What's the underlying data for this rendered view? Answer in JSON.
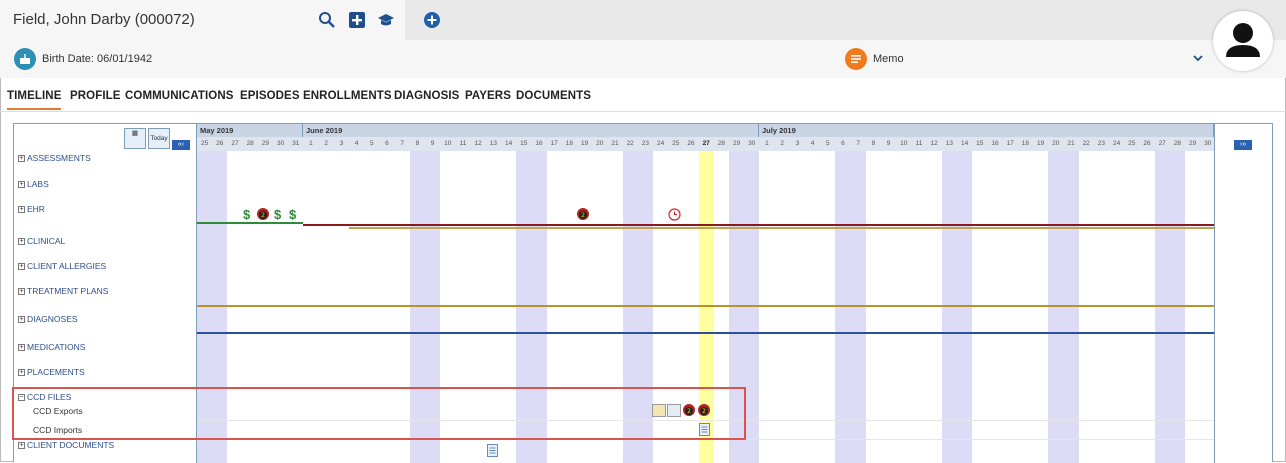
{
  "patient": {
    "name": "Field, John Darby (000072)",
    "birth_date": "Birth Date: 06/01/1942"
  },
  "memo": {
    "label": "Memo"
  },
  "tabs": [
    {
      "label": "TIMELINE",
      "active": true
    },
    {
      "label": "PROFILE"
    },
    {
      "label": "COMMUNICATIONS"
    },
    {
      "label": "EPISODES"
    },
    {
      "label": "ENROLLMENTS"
    },
    {
      "label": "DIAGNOSIS"
    },
    {
      "label": "PAYERS"
    },
    {
      "label": "DOCUMENTS"
    }
  ],
  "timeline": {
    "today_label": "Today",
    "months": [
      "May 2019",
      "June 2019",
      "July 2019"
    ],
    "categories": [
      "ASSESSMENTS",
      "LABS",
      "EHR",
      "CLINICAL",
      "CLIENT ALLERGIES",
      "TREATMENT PLANS",
      "DIAGNOSES",
      "MEDICATIONS",
      "PLACEMENTS",
      "CCD FILES",
      "CLIENT DOCUMENTS"
    ],
    "subcategories": [
      "CCD Exports",
      "CCD Imports"
    ],
    "days": [
      "25",
      "26",
      "27",
      "28",
      "29",
      "30",
      "31",
      "1",
      "2",
      "3",
      "4",
      "5",
      "6",
      "7",
      "8",
      "9",
      "10",
      "11",
      "12",
      "13",
      "14",
      "15",
      "16",
      "17",
      "18",
      "19",
      "20",
      "21",
      "22",
      "23",
      "24",
      "25",
      "26",
      "27",
      "28",
      "29",
      "30",
      "1",
      "2",
      "3",
      "4",
      "5",
      "6",
      "7",
      "8",
      "9",
      "10",
      "11",
      "12",
      "13",
      "14",
      "15",
      "16",
      "17",
      "18",
      "19",
      "20",
      "21",
      "22",
      "23",
      "24",
      "25",
      "26",
      "27",
      "28",
      "29",
      "30"
    ]
  },
  "colors": {
    "accent": "#e07b39",
    "weekend": "#dcdcf7",
    "today": "#ffff9e",
    "link": "#2e4e8e"
  },
  "icons": {
    "search": "search-icon",
    "add": "add-icon",
    "education": "graduation-cap-icon",
    "new": "plus-circle-icon",
    "birthday": "cake-icon",
    "memo": "memo-icon",
    "avatar": "user-avatar-icon"
  }
}
